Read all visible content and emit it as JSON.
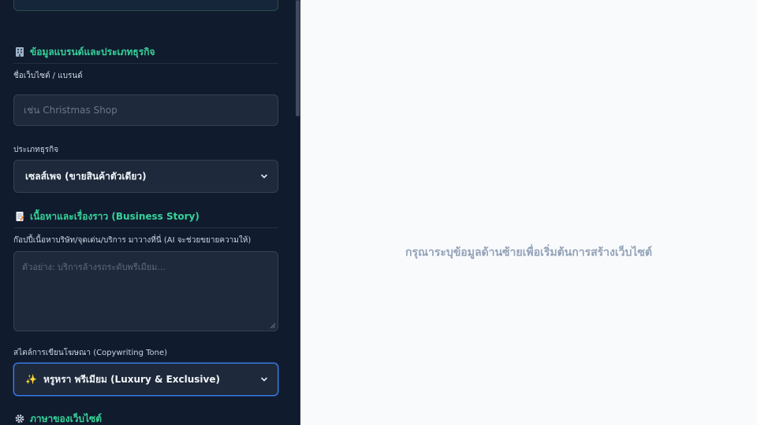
{
  "sidebar": {
    "brand_section": {
      "icon": "building-icon",
      "title": "ข้อมูลแบรนด์และประเภทธุรกิจ",
      "site_name_label": "ชื่อเว็บไซต์ / แบรนด์",
      "site_name_placeholder": "เช่น Christmas Shop",
      "business_type_label": "ประเภทธุรกิจ",
      "business_type_value": "เซลส์เพจ (ขายสินค้าตัวเดียว)"
    },
    "story_section": {
      "icon": "memo-icon",
      "title": "เนื้อหาและเรื่องราว (Business Story)",
      "story_label": "ก๊อปปี้เนื้อหาบริษัท/จุดเด่น/บริการ มาวางที่นี่ (AI จะช่วยขยายความให้)",
      "story_placeholder": "ตัวอย่าง: บริการล้างรถระดับพรีเมียม...",
      "tone_label": "สไตล์การเขียนโฆษณา (Copywriting Tone)",
      "tone_icon": "sparkles-icon",
      "tone_value": "หรูหรา พรีเมียม (Luxury & Exclusive)"
    },
    "language_section": {
      "icon": "gear-icon",
      "title": "ภาษาของเว็บไซต์"
    }
  },
  "main": {
    "message": "กรุณาระบุข้อมูลด้านซ้ายเพื่อเริ่มต้นการสร้างเว็บไซต์"
  },
  "colors": {
    "sidebar_bg": "#111b2e",
    "accent_green": "#34d399",
    "field_bg": "#1e293b",
    "focus_blue": "#3b82f6",
    "main_bg": "#f8fafc"
  }
}
